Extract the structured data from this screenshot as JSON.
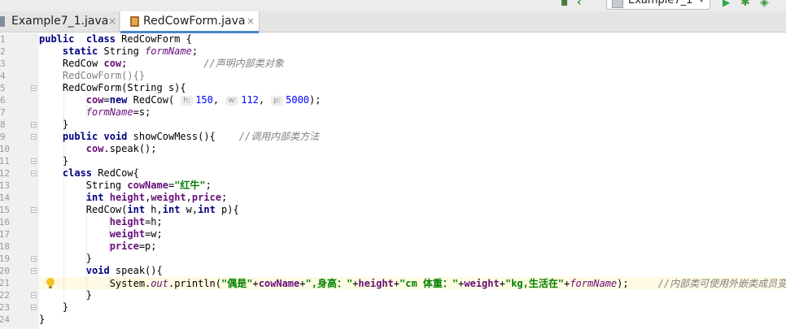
{
  "toolbar": {
    "run_config": "Example7_1",
    "icons": [
      "build-icon",
      "back-icon",
      "run-icon",
      "debug-icon",
      "coverage-icon"
    ],
    "colors": {
      "run": "#29a745",
      "debug": "#3b9a3b"
    }
  },
  "tabs": [
    {
      "label": "Example7_1.java",
      "close": "×",
      "active": false
    },
    {
      "label": "RedCowForm.java",
      "close": "×",
      "active": true
    }
  ],
  "editor": {
    "line_numbers": [
      "1",
      "2",
      "3",
      "4",
      "5",
      "6",
      "7",
      "8",
      "9",
      "10",
      "11",
      "12",
      "13",
      "14",
      "15",
      "16",
      "17",
      "18",
      "19",
      "20",
      "21",
      "22",
      "23",
      "24"
    ],
    "lines": [
      [
        [
          "kw",
          "public"
        ],
        [
          "",
          "  "
        ],
        [
          "kw",
          "class"
        ],
        [
          "",
          " RedCowForm {"
        ]
      ],
      [
        [
          "",
          "    "
        ],
        [
          "kw",
          "static"
        ],
        [
          "",
          " String "
        ],
        [
          "fldi",
          "formName"
        ],
        [
          "",
          ";"
        ]
      ],
      [
        [
          "",
          "    RedCow "
        ],
        [
          "fld",
          "cow"
        ],
        [
          "",
          ";             "
        ],
        [
          "cmt",
          "//声明内部类对象"
        ]
      ],
      [
        [
          "grey",
          "    RedCowForm(){}"
        ]
      ],
      [
        [
          "",
          "    RedCowForm(String s){"
        ]
      ],
      [
        [
          "",
          "        "
        ],
        [
          "fld",
          "cow"
        ],
        [
          "",
          "="
        ],
        [
          "kw",
          "new"
        ],
        [
          "",
          " RedCow( "
        ],
        [
          "hint",
          "h:"
        ],
        [
          "num",
          "150"
        ],
        [
          "",
          ", "
        ],
        [
          "hint",
          "w:"
        ],
        [
          "num",
          "112"
        ],
        [
          "",
          ", "
        ],
        [
          "hint",
          "p:"
        ],
        [
          "num",
          "5000"
        ],
        [
          "",
          ");"
        ]
      ],
      [
        [
          "",
          "        "
        ],
        [
          "fldi",
          "formName"
        ],
        [
          "",
          "=s;"
        ]
      ],
      [
        [
          "",
          "    }"
        ]
      ],
      [
        [
          "",
          "    "
        ],
        [
          "kw",
          "public"
        ],
        [
          "",
          " "
        ],
        [
          "kw",
          "void"
        ],
        [
          "",
          " showCowMess(){    "
        ],
        [
          "cmt",
          "//调用内部类方法"
        ]
      ],
      [
        [
          "",
          "        "
        ],
        [
          "fld",
          "cow"
        ],
        [
          "",
          ".speak();"
        ]
      ],
      [
        [
          "",
          "    }"
        ]
      ],
      [
        [
          "",
          "    "
        ],
        [
          "kw",
          "class"
        ],
        [
          "",
          " RedCow{"
        ]
      ],
      [
        [
          "",
          "        String "
        ],
        [
          "fld",
          "cowName"
        ],
        [
          "",
          "="
        ],
        [
          "str",
          "\"红牛\""
        ],
        [
          "",
          ";"
        ]
      ],
      [
        [
          "",
          "        "
        ],
        [
          "kw",
          "int"
        ],
        [
          "",
          " "
        ],
        [
          "fld",
          "height"
        ],
        [
          "",
          ","
        ],
        [
          "fld",
          "weight"
        ],
        [
          "",
          ","
        ],
        [
          "fld",
          "price"
        ],
        [
          "",
          ";"
        ]
      ],
      [
        [
          "",
          "        RedCow("
        ],
        [
          "kw",
          "int"
        ],
        [
          "",
          " h,"
        ],
        [
          "kw",
          "int"
        ],
        [
          "",
          " w,"
        ],
        [
          "kw",
          "int"
        ],
        [
          "",
          " p){"
        ]
      ],
      [
        [
          "",
          "            "
        ],
        [
          "fld",
          "height"
        ],
        [
          "",
          "=h;"
        ]
      ],
      [
        [
          "",
          "            "
        ],
        [
          "fld",
          "weight"
        ],
        [
          "",
          "=w;"
        ]
      ],
      [
        [
          "",
          "            "
        ],
        [
          "fld",
          "price"
        ],
        [
          "",
          "=p;"
        ]
      ],
      [
        [
          "",
          "        }"
        ]
      ],
      [
        [
          "",
          "        "
        ],
        [
          "kw",
          "void"
        ],
        [
          "",
          " speak(){"
        ]
      ],
      [
        [
          "",
          "            System."
        ],
        [
          "fldi",
          "out"
        ],
        [
          "",
          ".println("
        ],
        [
          "str",
          "\"偶是\""
        ],
        [
          "",
          "+"
        ],
        [
          "fld",
          "cowName"
        ],
        [
          "",
          "+"
        ],
        [
          "str",
          "\",身高：\""
        ],
        [
          "",
          "+"
        ],
        [
          "fld",
          "height"
        ],
        [
          "",
          "+"
        ],
        [
          "str",
          "\"cm 体重：\""
        ],
        [
          "",
          "+"
        ],
        [
          "fld",
          "weight"
        ],
        [
          "",
          "+"
        ],
        [
          "str",
          "\"kg,生活在\""
        ],
        [
          "",
          "+"
        ],
        [
          "fldi",
          "formName"
        ],
        [
          "",
          ");     "
        ],
        [
          "cmt",
          "//内部类可使用外嵌类成员变量"
        ]
      ],
      [
        [
          "",
          "        }"
        ]
      ],
      [
        [
          "",
          "    }"
        ]
      ],
      [
        [
          "",
          "}"
        ]
      ]
    ]
  }
}
